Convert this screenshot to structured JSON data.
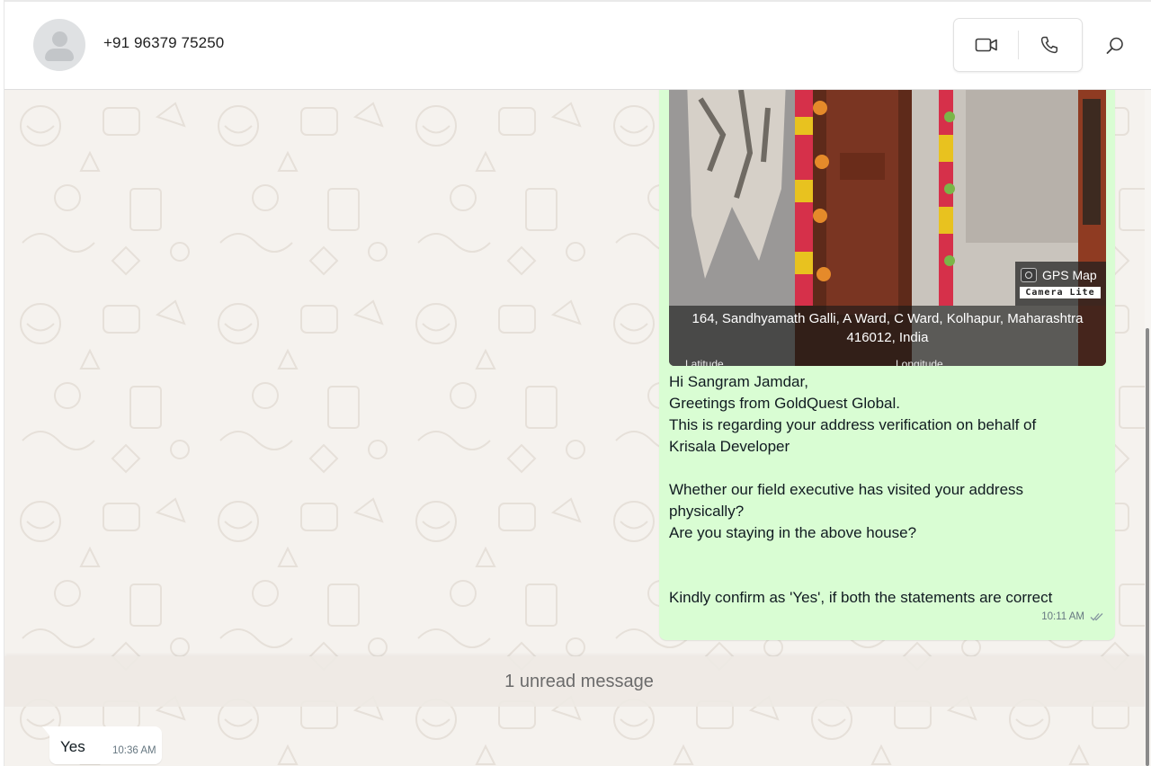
{
  "header": {
    "contact_name": "+91 96379 75250",
    "avatar_icon": "person-placeholder-icon",
    "video_call_icon": "video-camera-icon",
    "voice_call_icon": "phone-icon",
    "search_icon": "search-icon"
  },
  "outgoing_message": {
    "photo": {
      "gps_badge_title": "GPS Map",
      "gps_badge_subtitle": "Camera Lite",
      "address": "164, Sandhyamath Galli, A Ward, C Ward, Kolhapur, Maharashtra 416012, India",
      "latitude_label": "Latitude",
      "longitude_label": "Longitude"
    },
    "lines": [
      "Hi Sangram Jamdar,",
      "Greetings from GoldQuest Global.",
      "This is regarding your address verification on behalf of",
      "Krisala Developer",
      "",
      "Whether our field executive has visited your address",
      "physically?",
      "Are you staying in the above house?",
      "",
      "",
      "Kindly confirm as 'Yes', if both the statements are correct"
    ],
    "time": "10:11 AM",
    "status_icon": "double-check-icon",
    "bubble_color": "#d9fdd3"
  },
  "unread_divider": {
    "label": "1 unread message"
  },
  "incoming_message": {
    "text": "Yes",
    "time": "10:36 AM"
  },
  "colors": {
    "chat_background": "#f5f2ee",
    "incoming_bubble": "#ffffff",
    "meta_text": "#667781"
  }
}
